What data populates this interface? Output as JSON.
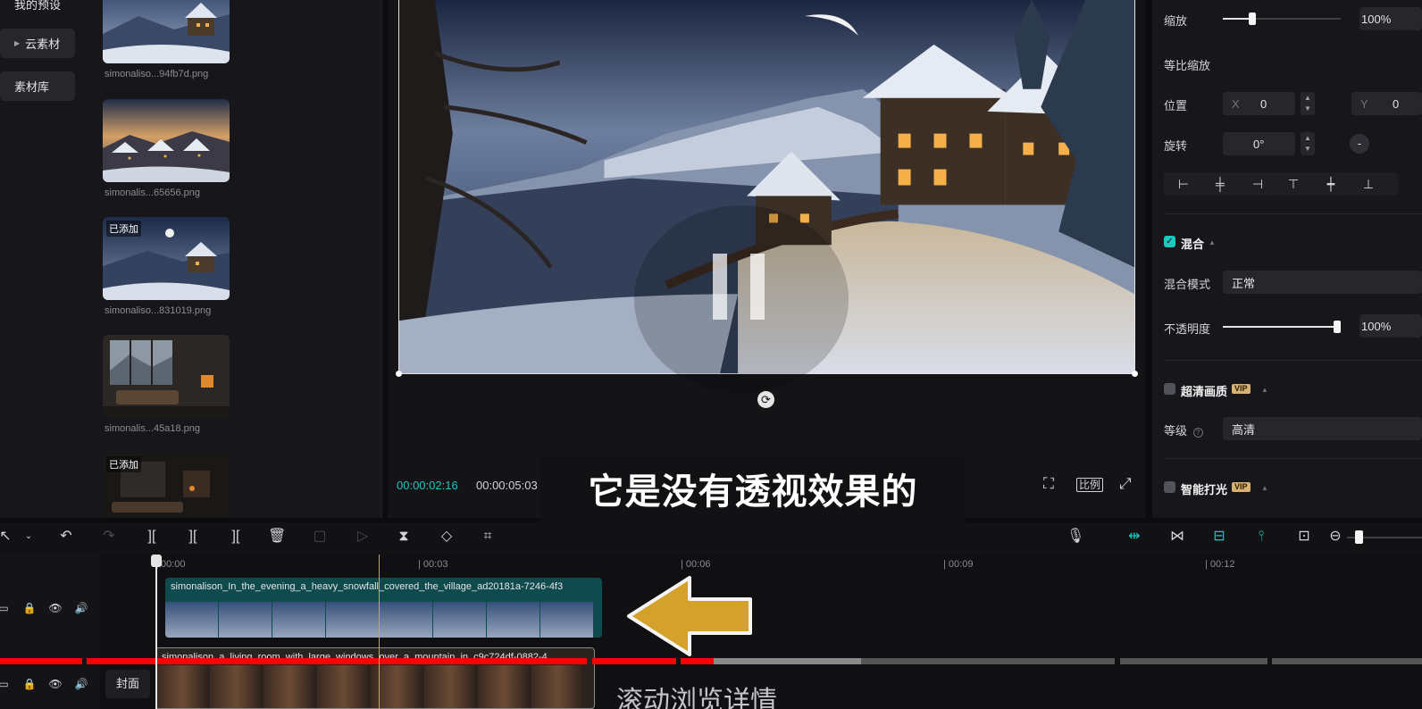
{
  "left_nav": {
    "items": [
      {
        "label": "我的预设",
        "active": false
      },
      {
        "label": "云素材",
        "active": true
      },
      {
        "label": "素材库",
        "active": false
      }
    ]
  },
  "media": {
    "items": [
      {
        "name": "simonaliso...94fb7d.png",
        "badge": ""
      },
      {
        "name": "simonalis...65656.png",
        "badge": ""
      },
      {
        "name": "simonaliso...831019.png",
        "badge": "已添加"
      },
      {
        "name": "simonalis...45a18.png",
        "badge": ""
      },
      {
        "name": "",
        "badge": "已添加"
      }
    ]
  },
  "preview": {
    "current_time": "00:00:02:16",
    "total_time": "00:00:05:03",
    "ratio_label": "比例",
    "subtitle": "它是没有透视效果的",
    "playing": false
  },
  "properties": {
    "scale_label": "缩放",
    "scale_value": "100%",
    "scale_level": 0.25,
    "uniform_scale_label": "等比缩放",
    "position_label": "位置",
    "pos_x_label": "X",
    "pos_x_value": "0",
    "pos_y_label": "Y",
    "pos_y_value": "0",
    "rotate_label": "旋转",
    "rotate_value": "0°",
    "rotate_button": "-",
    "blend_title": "混合",
    "blend_enabled": true,
    "blend_mode_label": "混合模式",
    "blend_mode_value": "正常",
    "opacity_label": "不透明度",
    "opacity_value": "100%",
    "opacity_level": 1.0,
    "hd_title": "超清画质",
    "hd_vip": "VIP",
    "hd_enabled": false,
    "level_label": "等级",
    "level_value": "高清",
    "smart_light_title": "智能打光",
    "smart_light_vip": "VIP",
    "smart_light_enabled": false
  },
  "timeline": {
    "ruler": [
      "00:00",
      "| 00:03",
      "| 00:06",
      "| 00:09",
      "| 00:12"
    ],
    "clips": [
      {
        "title": "simonalison_In_the_evening_a_heavy_snowfall_covered_the_village_ad20181a-7246-4f3"
      },
      {
        "title": "simonalison_a_living_room_with_large_windows_over_a_mountain_in_c9c724df-0882-4"
      }
    ],
    "cover_label": "封面",
    "overlay_text": "滚动浏览详情"
  },
  "colors": {
    "accent": "#1ec7c0",
    "arrow": "#d4a22a",
    "progress_red": "#ff0000",
    "vip_gold": "#d8b272"
  }
}
